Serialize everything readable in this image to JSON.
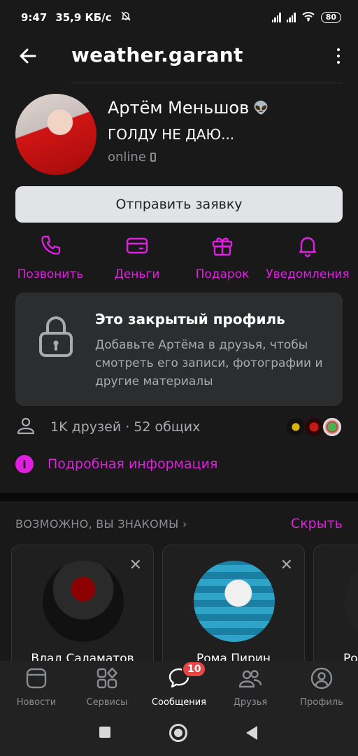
{
  "status_bar": {
    "time": "9:47",
    "speed": "35,9 КБ/с",
    "battery": "80"
  },
  "header": {
    "title": "weather.garant",
    "back_icon": "arrow-left-icon",
    "menu_icon": "more-vertical-icon"
  },
  "profile": {
    "name": "Артём Меньшов",
    "name_emoji": "👽",
    "status": "ГОЛДУ НЕ ДАЮ...",
    "online": "online"
  },
  "request_button": "Отправить заявку",
  "actions": [
    {
      "label": "Позвонить",
      "icon": "phone-icon"
    },
    {
      "label": "Деньги",
      "icon": "money-icon"
    },
    {
      "label": "Подарок",
      "icon": "gift-icon"
    },
    {
      "label": "Уведомления",
      "icon": "bell-icon"
    }
  ],
  "privacy": {
    "title": "Это закрытый профиль",
    "text": "Добавьте Артёма в друзья, чтобы смотреть его записи, фотографии и другие материалы"
  },
  "friends": {
    "text": "1K друзей · 52 общих"
  },
  "info_link": {
    "text": "Подробная информация"
  },
  "pymk": {
    "title": "ВОЗМОЖНО, ВЫ ЗНАКОМЫ",
    "hide": "Скрыть",
    "cards": [
      {
        "name": "Влад Саламатов"
      },
      {
        "name": "Рома Пирин"
      },
      {
        "name": "Ро"
      }
    ]
  },
  "tabs": [
    {
      "label": "Новости",
      "icon": "news-icon"
    },
    {
      "label": "Сервисы",
      "icon": "services-icon"
    },
    {
      "label": "Сообщения",
      "icon": "messages-icon",
      "badge": "10"
    },
    {
      "label": "Друзья",
      "icon": "friends-icon"
    },
    {
      "label": "Профиль",
      "icon": "profile-icon"
    }
  ],
  "colors": {
    "accent": "#e01fe0",
    "background": "#19191a",
    "card": "#2c2d2e",
    "badge": "#e64646"
  }
}
